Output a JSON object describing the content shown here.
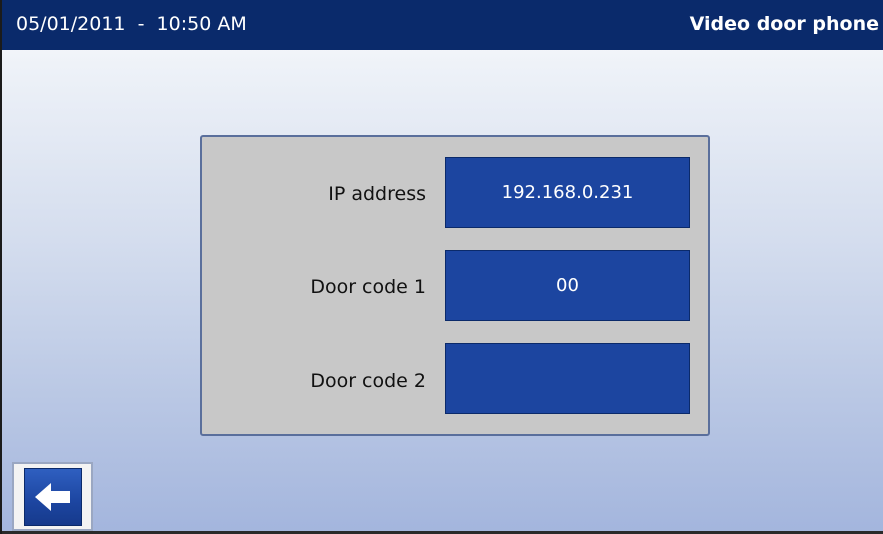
{
  "header": {
    "datetime": "05/01/2011  -  10:50 AM",
    "app_title": "Video door phone"
  },
  "fields": [
    {
      "label": "IP address",
      "value": "192.168.0.231"
    },
    {
      "label": "Door code 1",
      "value": "00"
    },
    {
      "label": "Door code 2",
      "value": ""
    }
  ],
  "back_button": {
    "icon": "arrow-left-icon"
  },
  "colors": {
    "title_bar": "#0a2a6b",
    "field_bg": "#1c45a0",
    "panel_bg": "#c8c8c8"
  }
}
